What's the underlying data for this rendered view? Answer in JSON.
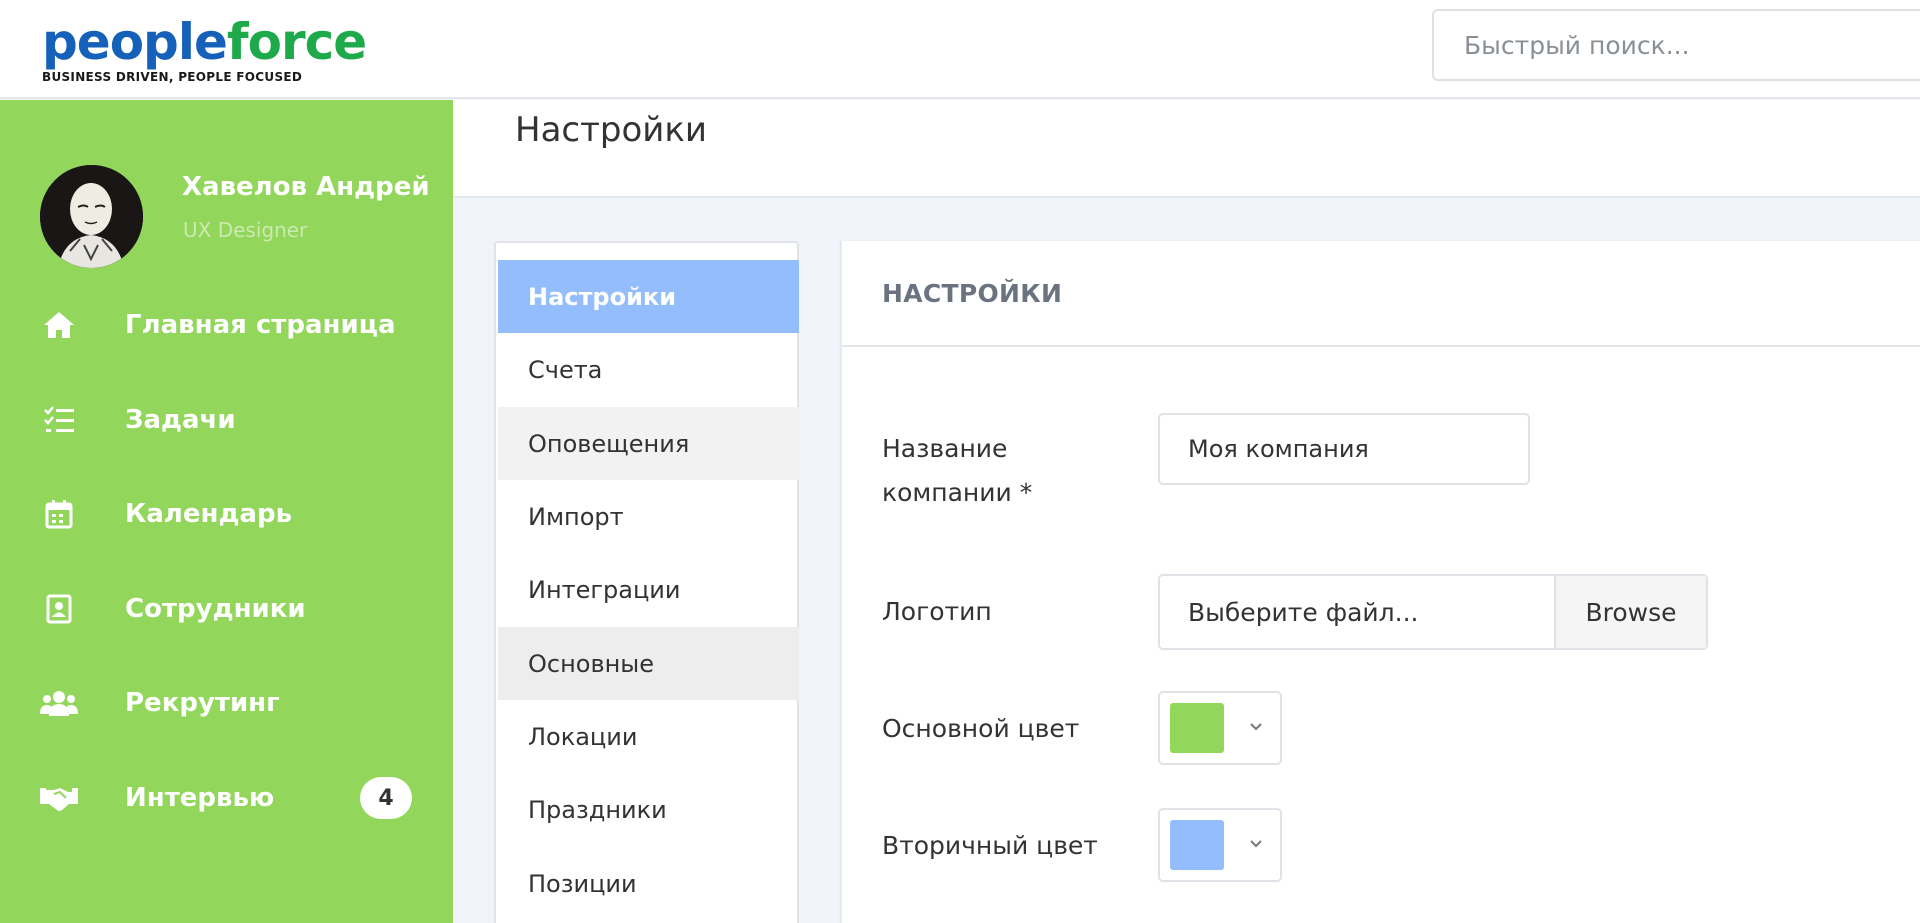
{
  "header": {
    "logo": {
      "brand_people": "people",
      "brand_force": "force",
      "tagline": "BUSINESS DRIVEN, PEOPLE FOCUSED"
    },
    "search": {
      "placeholder": "Быстрый поиск..."
    }
  },
  "sidebar": {
    "user": {
      "name": "Хавелов Андрей",
      "role": "UX Designer"
    },
    "items": [
      {
        "label": "Главная страница",
        "icon": "home-icon"
      },
      {
        "label": "Задачи",
        "icon": "tasks-icon"
      },
      {
        "label": "Календарь",
        "icon": "calendar-icon"
      },
      {
        "label": "Сотрудники",
        "icon": "employee-card-icon"
      },
      {
        "label": "Рекрутинг",
        "icon": "users-icon"
      },
      {
        "label": "Интервью",
        "icon": "handshake-icon",
        "badge": "4"
      }
    ]
  },
  "page": {
    "title": "Настройки"
  },
  "submenu": {
    "items": [
      {
        "label": "Настройки"
      },
      {
        "label": "Счета"
      },
      {
        "label": "Оповещения"
      },
      {
        "label": "Импорт"
      },
      {
        "label": "Интеграции"
      },
      {
        "label": "Основные"
      },
      {
        "label": "Локации"
      },
      {
        "label": "Праздники"
      },
      {
        "label": "Позиции"
      }
    ]
  },
  "panel": {
    "title": "НАСТРОЙКИ",
    "company": {
      "label_line1": "Название",
      "label_line2": "компании *",
      "value": "Моя компания"
    },
    "logo": {
      "label": "Логотип",
      "file_placeholder": "Выберите файл...",
      "browse": "Browse"
    },
    "primary_color": {
      "label": "Основной цвет",
      "value": "#92d65c"
    },
    "secondary_color": {
      "label": "Вторичный цвет",
      "value": "#94bdfd"
    }
  },
  "theme": {
    "sidebar_bg": "#92d65c",
    "active_submenu": "#94bdfd",
    "brand_blue": "#1560b8",
    "brand_green": "#1eaa4a"
  }
}
